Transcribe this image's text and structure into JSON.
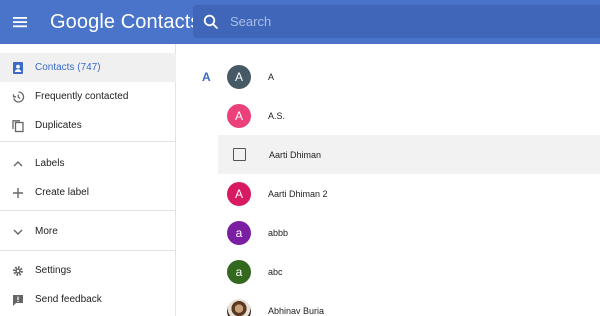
{
  "header": {
    "title": "Google Contacts",
    "search_placeholder": "Search",
    "menu_icon": "hamburger-menu-icon",
    "search_icon": "search-icon",
    "color": "#4a74c9"
  },
  "sidebar": {
    "items": [
      {
        "label": "Contacts (747)",
        "icon": "contacts-icon",
        "active": true
      },
      {
        "label": "Frequently contacted",
        "icon": "history-icon"
      },
      {
        "label": "Duplicates",
        "icon": "duplicates-icon"
      },
      {
        "label": "Labels",
        "icon": "chevron-up-icon"
      },
      {
        "label": "Create label",
        "icon": "plus-icon"
      },
      {
        "label": "More",
        "icon": "chevron-down-icon"
      },
      {
        "label": "Settings",
        "icon": "gear-icon"
      },
      {
        "label": "Send feedback",
        "icon": "feedback-icon"
      }
    ],
    "accent": "#3a6bc9"
  },
  "main": {
    "section_letter": "A",
    "contacts": [
      {
        "name": "A",
        "initial": "A",
        "color": "#455a64"
      },
      {
        "name": "A.S.",
        "initial": "A",
        "color": "#ec407a"
      },
      {
        "name": "Aarti Dhiman",
        "initial": "",
        "checkbox": true
      },
      {
        "name": "Aarti Dhiman 2",
        "initial": "A",
        "color": "#d81b60"
      },
      {
        "name": "abbb",
        "initial": "a",
        "color": "#7b1fa2"
      },
      {
        "name": "abc",
        "initial": "a",
        "color": "#33691e"
      },
      {
        "name": "Abhinav Buria",
        "initial": "",
        "photo": true
      }
    ]
  }
}
